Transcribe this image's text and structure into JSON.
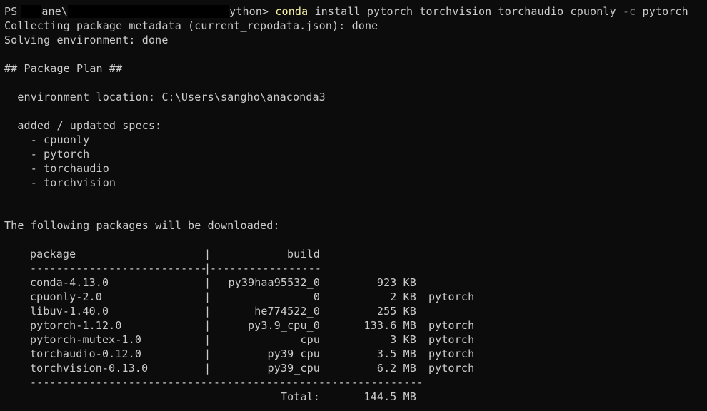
{
  "prompt": {
    "prefix": "PS",
    "path_fragment_1": "ane\\",
    "path_fragment_2": "ython> ",
    "command": "conda",
    "args": " install pytorch torchvision torchaudio cpuonly ",
    "flag": "-c",
    "channel": " pytorch"
  },
  "output": {
    "collect": "Collecting package metadata (current_repodata.json): done",
    "solve": "Solving environment: done",
    "plan_header": "## Package Plan ##",
    "env_location": "  environment location: C:\\Users\\sangho\\anaconda3",
    "specs_header": "  added / updated specs:",
    "specs": [
      "    - cpuonly",
      "    - pytorch",
      "    - torchaudio",
      "    - torchvision"
    ],
    "download_header": "The following packages will be downloaded:"
  },
  "table": {
    "col_package": "package",
    "col_build": "build",
    "sep_left": "---------------------------",
    "sep_pipe": "|",
    "sep_right": "-----------------",
    "pipe": "|",
    "rows": [
      {
        "package": "conda-4.13.0",
        "build": "py39haa95532_0",
        "size": "923 KB",
        "channel": ""
      },
      {
        "package": "cpuonly-2.0",
        "build": "0",
        "size": "2 KB",
        "channel": "pytorch"
      },
      {
        "package": "libuv-1.40.0",
        "build": "he774522_0",
        "size": "255 KB",
        "channel": ""
      },
      {
        "package": "pytorch-1.12.0",
        "build": "py3.9_cpu_0",
        "size": "133.6 MB",
        "channel": "pytorch"
      },
      {
        "package": "pytorch-mutex-1.0",
        "build": "cpu",
        "size": "3 KB",
        "channel": "pytorch"
      },
      {
        "package": "torchaudio-0.12.0",
        "build": "py39_cpu",
        "size": "3.5 MB",
        "channel": "pytorch"
      },
      {
        "package": "torchvision-0.13.0",
        "build": "py39_cpu",
        "size": "6.2 MB",
        "channel": "pytorch"
      }
    ],
    "bottom_sep": "------------------------------------------------------------",
    "total_label": "Total:",
    "total_value": "144.5 MB"
  },
  "colors": {
    "background": "#0c0c0c",
    "text": "#cccccc",
    "command": "#f9f1a5",
    "flag": "#767676"
  }
}
